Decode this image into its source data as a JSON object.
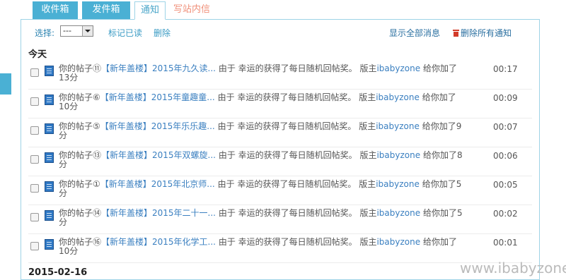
{
  "tabs": [
    {
      "label": "收件箱"
    },
    {
      "label": "发件箱"
    },
    {
      "label": "通知"
    },
    {
      "label": "写站内信"
    }
  ],
  "toolbar": {
    "select_label": "选择:",
    "select_value": "---",
    "mark_read": "标记已读",
    "delete": "删除",
    "show_all": "显示全部消息",
    "delete_all": "删除所有通知"
  },
  "sections": {
    "today": "今天",
    "next_date": "2015-02-16"
  },
  "notifications": [
    {
      "post_prefix": "你的帖子⑪",
      "title": "【新年盖楼】2015年九久读...",
      "middle": "由于 幸运的获得了每日随机回帖奖。 版主",
      "user": "ibabyzone",
      "suffix_l1": "给你加了",
      "suffix_l2": "13分",
      "time": "00:17"
    },
    {
      "post_prefix": "你的帖子⑥",
      "title": "【新年盖楼】2015年童趣童...",
      "middle": "由于 幸运的获得了每日随机回帖奖。 版主",
      "user": "ibabyzone",
      "suffix_l1": "给你加了",
      "suffix_l2": "10分",
      "time": "00:09"
    },
    {
      "post_prefix": "你的帖子⑤",
      "title": "【新年盖楼】2015年乐乐趣...",
      "middle": "由于 幸运的获得了每日随机回帖奖。 版主",
      "user": "ibabyzone",
      "suffix_l1": "给你加了9",
      "suffix_l2": "分",
      "time": "00:07"
    },
    {
      "post_prefix": "你的帖子⑬",
      "title": "【新年盖楼】2015年双螺旋...",
      "middle": "由于 幸运的获得了每日随机回帖奖。 版主",
      "user": "ibabyzone",
      "suffix_l1": "给你加了8",
      "suffix_l2": "分",
      "time": "00:06"
    },
    {
      "post_prefix": "你的帖子①",
      "title": "【新年盖楼】2015年北京师...",
      "middle": "由于 幸运的获得了每日随机回帖奖。 版主",
      "user": "ibabyzone",
      "suffix_l1": "给你加了5",
      "suffix_l2": "分",
      "time": "00:05"
    },
    {
      "post_prefix": "你的帖子⑭",
      "title": "【新年盖楼】2015年二十一...",
      "middle": "由于 幸运的获得了每日随机回帖奖。 版主",
      "user": "ibabyzone",
      "suffix_l1": "给你加了5",
      "suffix_l2": "分",
      "time": "00:02"
    },
    {
      "post_prefix": "你的帖子⑯",
      "title": "【新年盖楼】2015年化学工...",
      "middle": "由于 幸运的获得了每日随机回帖奖。 版主",
      "user": "ibabyzone",
      "suffix_l1": "给你加了",
      "suffix_l2": "10分",
      "time": "00:01"
    }
  ],
  "watermark": "www.ibabyzone.cn",
  "colors": {
    "accent": "#4ab0d4",
    "link": "#3a7fc0",
    "write_tab": "#f0907a",
    "delete_icon": "#d23b2a"
  }
}
